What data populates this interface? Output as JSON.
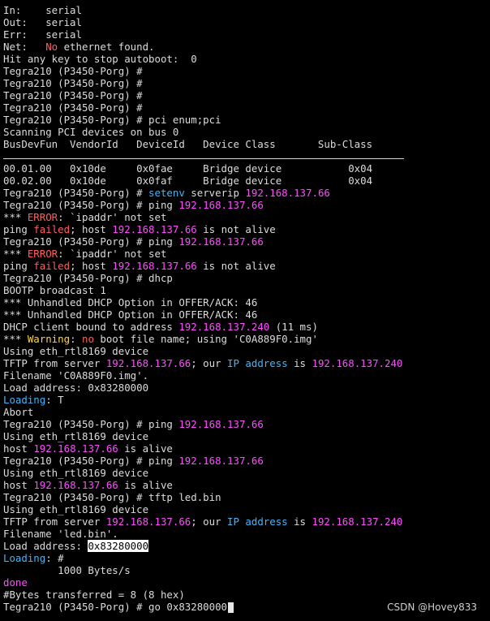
{
  "colors": {
    "background": "#000000",
    "text": "#dcdcdc",
    "error": "#ff5f5f",
    "ip": "#ff4dff",
    "keyword": "#3fb7ff",
    "warning": "#ffd84a"
  },
  "terminal": {
    "lines": [
      [
        {
          "t": "In:    serial"
        }
      ],
      [
        {
          "t": "Out:   serial"
        }
      ],
      [
        {
          "t": "Err:   serial"
        }
      ],
      [
        {
          "t": "Net:   "
        },
        {
          "t": "No",
          "c": "red"
        },
        {
          "t": " ethernet found."
        }
      ],
      [
        {
          "t": "Hit any key to stop autoboot:  0"
        }
      ],
      [
        {
          "t": "Tegra210 (P3450-Porg) #"
        }
      ],
      [
        {
          "t": "Tegra210 (P3450-Porg) #"
        }
      ],
      [
        {
          "t": "Tegra210 (P3450-Porg) #"
        }
      ],
      [
        {
          "t": "Tegra210 (P3450-Porg) #"
        }
      ],
      [
        {
          "t": "Tegra210 (P3450-Porg) # pci enum;pci"
        }
      ],
      [
        {
          "t": "Scanning PCI devices on bus 0"
        }
      ],
      [
        {
          "t": "BusDevFun  VendorId   DeviceId   Device Class       Sub-Class"
        }
      ],
      [
        {
          "t": ""
        }
      ],
      [
        {
          "t": "00.01.00   0x10de     0x0fae     Bridge device           0x04"
        }
      ],
      [
        {
          "t": "00.02.00   0x10de     0x0faf     Bridge device           0x04"
        }
      ],
      [
        {
          "t": "Tegra210 (P3450-Porg) # "
        },
        {
          "t": "setenv",
          "c": "cyan"
        },
        {
          "t": " serverip "
        },
        {
          "t": "192.168.137.66",
          "c": "magenta"
        }
      ],
      [
        {
          "t": "Tegra210 (P3450-Porg) # ping "
        },
        {
          "t": "192.168.137.66",
          "c": "magenta"
        }
      ],
      [
        {
          "t": "*** "
        },
        {
          "t": "ERROR",
          "c": "red"
        },
        {
          "t": ": `ipaddr' not set"
        }
      ],
      [
        {
          "t": "ping "
        },
        {
          "t": "failed",
          "c": "red"
        },
        {
          "t": "; host "
        },
        {
          "t": "192.168.137.66",
          "c": "magenta"
        },
        {
          "t": " is not alive"
        }
      ],
      [
        {
          "t": "Tegra210 (P3450-Porg) # ping "
        },
        {
          "t": "192.168.137.66",
          "c": "magenta"
        }
      ],
      [
        {
          "t": "*** "
        },
        {
          "t": "ERROR",
          "c": "red"
        },
        {
          "t": ": `ipaddr' not set"
        }
      ],
      [
        {
          "t": "ping "
        },
        {
          "t": "failed",
          "c": "red"
        },
        {
          "t": "; host "
        },
        {
          "t": "192.168.137.66",
          "c": "magenta"
        },
        {
          "t": " is not alive"
        }
      ],
      [
        {
          "t": "Tegra210 (P3450-Porg) # dhcp"
        }
      ],
      [
        {
          "t": "BOOTP broadcast 1"
        }
      ],
      [
        {
          "t": "*** Unhandled DHCP Option in OFFER/ACK: 46"
        }
      ],
      [
        {
          "t": "*** Unhandled DHCP Option in OFFER/ACK: 46"
        }
      ],
      [
        {
          "t": "DHCP client bound to address "
        },
        {
          "t": "192.168.137.240",
          "c": "magenta"
        },
        {
          "t": " (11 ms)"
        }
      ],
      [
        {
          "t": "*** "
        },
        {
          "t": "Warning",
          "c": "yellow"
        },
        {
          "t": ": "
        },
        {
          "t": "no",
          "c": "red"
        },
        {
          "t": " boot file name; using 'C0A889F0.img'"
        }
      ],
      [
        {
          "t": "Using eth_rtl8169 device"
        }
      ],
      [
        {
          "t": "TFTP from server "
        },
        {
          "t": "192.168.137.66",
          "c": "magenta"
        },
        {
          "t": "; our "
        },
        {
          "t": "IP address",
          "c": "cyan"
        },
        {
          "t": " is "
        },
        {
          "t": "192.168.137.240",
          "c": "magenta"
        }
      ],
      [
        {
          "t": "Filename 'C0A889F0.img'."
        }
      ],
      [
        {
          "t": "Load address: 0x83280000"
        }
      ],
      [
        {
          "t": "Loading",
          "c": "cyan"
        },
        {
          "t": ": T"
        }
      ],
      [
        {
          "t": "Abort"
        }
      ],
      [
        {
          "t": "Tegra210 (P3450-Porg) # ping "
        },
        {
          "t": "192.168.137.66",
          "c": "magenta"
        }
      ],
      [
        {
          "t": "Using eth_rtl8169 device"
        }
      ],
      [
        {
          "t": "host "
        },
        {
          "t": "192.168.137.66",
          "c": "magenta"
        },
        {
          "t": " is alive"
        }
      ],
      [
        {
          "t": "Tegra210 (P3450-Porg) # ping "
        },
        {
          "t": "192.168.137.66",
          "c": "magenta"
        }
      ],
      [
        {
          "t": "Using eth_rtl8169 device"
        }
      ],
      [
        {
          "t": "host "
        },
        {
          "t": "192.168.137.66",
          "c": "magenta"
        },
        {
          "t": " is alive"
        }
      ],
      [
        {
          "t": "Tegra210 (P3450-Porg) # tftp led.bin"
        }
      ],
      [
        {
          "t": "Using eth_rtl8169 device"
        }
      ],
      [
        {
          "t": "TFTP from server "
        },
        {
          "t": "192.168.137.66",
          "c": "magenta"
        },
        {
          "t": "; our "
        },
        {
          "t": "IP address",
          "c": "cyan"
        },
        {
          "t": " is "
        },
        {
          "t": "192.168.137.240",
          "c": "magenta"
        }
      ],
      [
        {
          "t": "Filename 'led.bin'."
        }
      ],
      [
        {
          "t": "Load address: "
        },
        {
          "t": "0x83280000",
          "c": "hl"
        }
      ],
      [
        {
          "t": "Loading",
          "c": "cyan"
        },
        {
          "t": ": #"
        }
      ],
      [
        {
          "t": "         1000 Bytes/s"
        }
      ],
      [
        {
          "t": "done",
          "c": "magenta"
        }
      ],
      [
        {
          "t": "#Bytes transferred = 8 (8 hex)"
        }
      ],
      [
        {
          "t": "Tegra210 (P3450-Porg) # go 0x83280000"
        }
      ]
    ]
  },
  "watermark": "CSDN @Hovey833"
}
